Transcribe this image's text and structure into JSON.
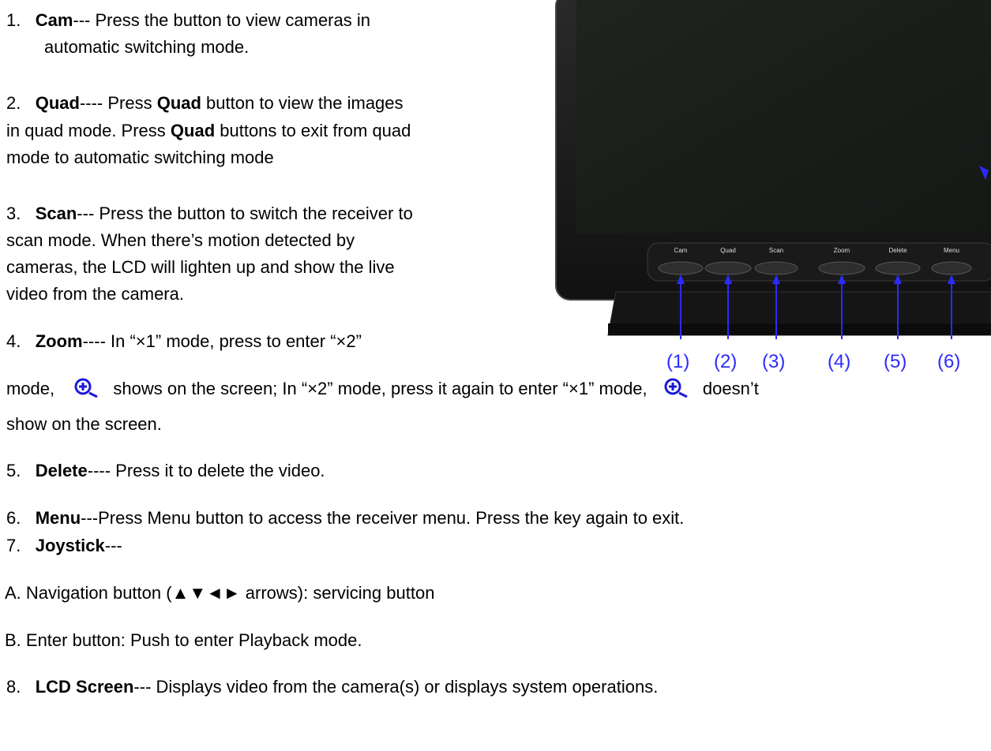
{
  "items": {
    "cam": {
      "num": "1.",
      "title": "Cam",
      "l1": "--- Press the button to view cameras in",
      "l2": "automatic switching mode."
    },
    "quad": {
      "num": "2.",
      "title": "Quad",
      "l1a": "---- Press ",
      "l1b": "Quad",
      "l1c": " button to view the images",
      "l2a": "in quad mode. Press ",
      "l2b": "Quad",
      "l2c": " buttons to exit from quad",
      "l3": "mode to automatic switching mode"
    },
    "scan": {
      "num": "3.",
      "title": "Scan",
      "l1": "--- Press the button to switch the receiver to",
      "l2": "scan mode. When there’s motion detected by",
      "l3": "cameras, the LCD will lighten up and show the live",
      "l4": "video from the camera."
    },
    "zoom": {
      "num": "4.",
      "title": "Zoom",
      "l1": "---- In “×1” mode, press to enter “×2”",
      "l2a": "mode,",
      "l2b": "shows on the screen; In “×2” mode, press it again to enter “×1” mode,",
      "l2c": "doesn’t",
      "l3": "show on the screen."
    },
    "delete": {
      "num": "5.",
      "title": "Delete",
      "text": "---- Press it to delete the video."
    },
    "menu": {
      "num": "6.",
      "title": "Menu",
      "text": "---Press Menu button to access the receiver menu. Press the key again to exit."
    },
    "joystick": {
      "num": "7.",
      "title": "Joystick",
      "text": "---"
    },
    "nav": {
      "text": "A. Navigation button (▲▼◄► arrows): servicing button"
    },
    "enter": {
      "text": "B. Enter button: Push to enter Playback mode."
    },
    "lcd": {
      "num": "8.",
      "title": "LCD Screen",
      "text": "--- Displays video from the camera(s) or displays system operations."
    }
  },
  "monitor": {
    "button_labels": [
      "Cam",
      "Quad",
      "Scan",
      "Zoom",
      "Delete",
      "Menu"
    ],
    "callouts": [
      "(1)",
      "(2)",
      "(3)",
      "(4)",
      "(5)",
      "(6)"
    ],
    "callout_color": "#2b2bff"
  },
  "icons": {
    "zoom": "zoom-in-icon"
  }
}
